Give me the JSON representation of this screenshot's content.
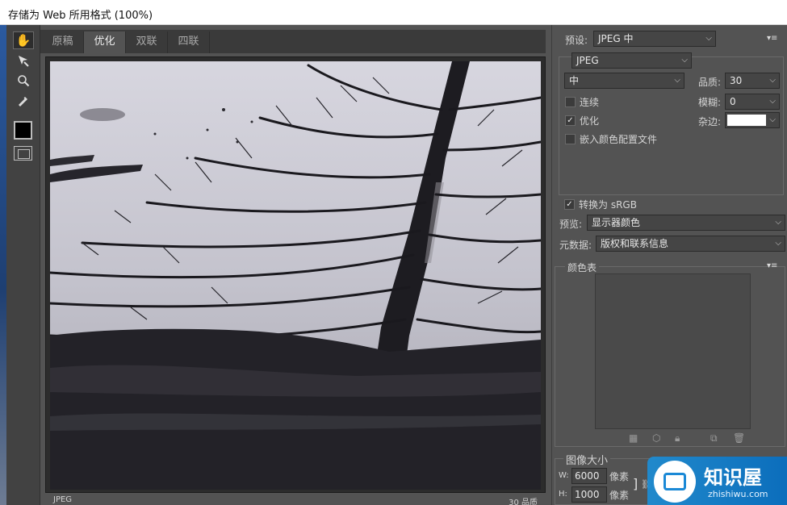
{
  "window": {
    "title": "存储为 Web 所用格式 (100%)"
  },
  "tools": {
    "hand": "hand-tool",
    "slice_select": "slice-select-tool",
    "zoom": "zoom-tool",
    "eyedropper": "eyedropper-tool"
  },
  "tabs": [
    {
      "label": "原稿"
    },
    {
      "label": "优化"
    },
    {
      "label": "双联"
    },
    {
      "label": "四联"
    }
  ],
  "status": {
    "format": "JPEG",
    "quality": "30 品质"
  },
  "settings": {
    "preset_label": "预设:",
    "preset_value": "JPEG 中",
    "format_value": "JPEG",
    "compression_value": "中",
    "quality_label": "品质:",
    "quality_value": "30",
    "progressive_label": "连续",
    "progressive_checked": false,
    "blur_label": "模糊:",
    "blur_value": "0",
    "optimized_label": "优化",
    "optimized_checked": true,
    "matte_label": "杂边:",
    "matte_color": "#ffffff",
    "embed_profile_label": "嵌入颜色配置文件",
    "embed_profile_checked": false,
    "convert_srgb_label": "转换为 sRGB",
    "convert_srgb_checked": true,
    "preview_label": "预览:",
    "preview_value": "显示器颜色",
    "metadata_label": "元数据:",
    "metadata_value": "版权和联系信息"
  },
  "color_table": {
    "title": "颜色表"
  },
  "image_size": {
    "title": "图像大小",
    "w_label": "W:",
    "w_value": "6000",
    "h_label": "H:",
    "h_value": "1000",
    "unit": "像素"
  },
  "watermark": {
    "name": "知识屋",
    "url": "zhishiwu.com"
  }
}
